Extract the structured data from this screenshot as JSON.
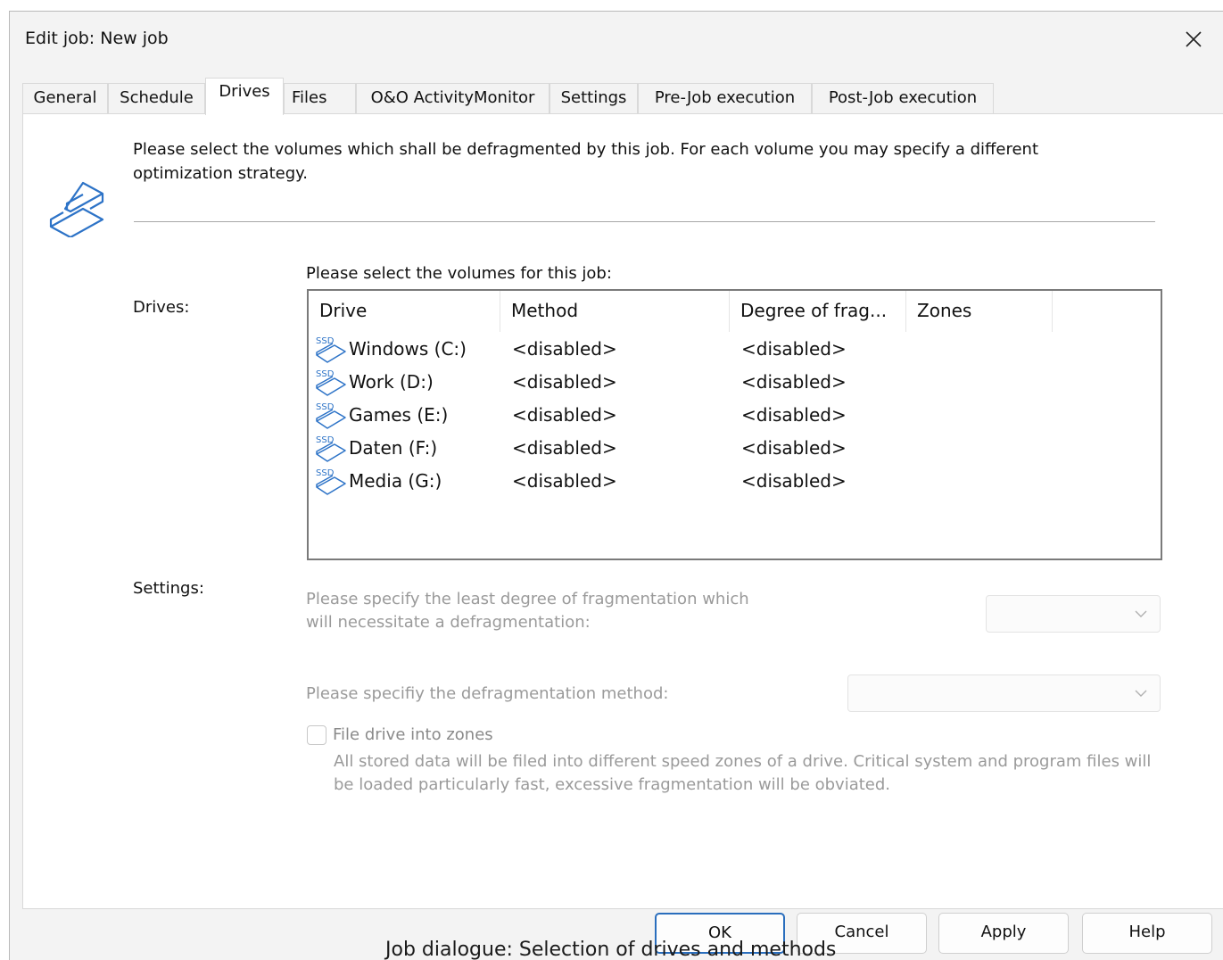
{
  "window": {
    "title": "Edit job: New job"
  },
  "tabs": [
    {
      "label": "General"
    },
    {
      "label": "Schedule"
    },
    {
      "label": "Drives"
    },
    {
      "label": "Files"
    },
    {
      "label": "O&O ActivityMonitor"
    },
    {
      "label": "Settings"
    },
    {
      "label": "Pre-Job execution"
    },
    {
      "label": "Post-Job execution"
    }
  ],
  "active_tab": "Drives",
  "drives_page": {
    "intro": "Please select the volumes which shall be defragmented by this job. For each volume you may specify a different optimization strategy.",
    "drives_label": "Drives:",
    "list_caption": "Please select the volumes for this job:",
    "columns": [
      "Drive",
      "Method",
      "Degree of frag...",
      "Zones"
    ],
    "rows": [
      {
        "icon": "ssd-drive-icon",
        "drive": "Windows (C:)",
        "method": "<disabled>",
        "degree": "<disabled>",
        "zones": ""
      },
      {
        "icon": "ssd-drive-icon",
        "drive": "Work (D:)",
        "method": "<disabled>",
        "degree": "<disabled>",
        "zones": ""
      },
      {
        "icon": "ssd-drive-icon",
        "drive": "Games (E:)",
        "method": "<disabled>",
        "degree": "<disabled>",
        "zones": ""
      },
      {
        "icon": "ssd-drive-icon",
        "drive": "Daten (F:)",
        "method": "<disabled>",
        "degree": "<disabled>",
        "zones": ""
      },
      {
        "icon": "ssd-drive-icon",
        "drive": "Media (G:)",
        "method": "<disabled>",
        "degree": "<disabled>",
        "zones": ""
      }
    ],
    "settings_label": "Settings:",
    "fragmentation_prompt_line1": "Please specify the least degree of fragmentation which",
    "fragmentation_prompt_line2": "will necessitate a defragmentation:",
    "fragmentation_value": "",
    "method_prompt": "Please specifiy the defragmentation method:",
    "method_value": "",
    "zones_checkbox_label": "File drive into zones",
    "zones_checked": false,
    "zones_description": "All stored data will be filed into different speed zones of a drive. Critical system and program files will be loaded particularly fast, excessive fragmentation will be obviated.",
    "ssd_badge": "SSD"
  },
  "buttons": {
    "ok": "OK",
    "cancel": "Cancel",
    "apply": "Apply",
    "help": "Help"
  },
  "caption": "Job dialogue: Selection of drives and methods"
}
